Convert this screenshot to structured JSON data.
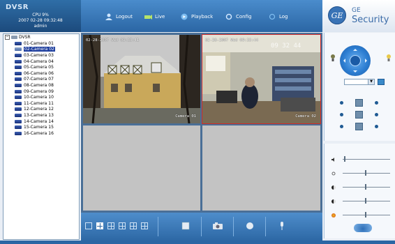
{
  "header": {
    "brand": "DVSR",
    "cpu": "CPU 9%",
    "datetime": "2007 02-28 09:32:48",
    "user": "admin"
  },
  "nav": {
    "tabs": [
      {
        "label": "Logout",
        "icon": "logout-icon"
      },
      {
        "label": "Live",
        "icon": "live-icon"
      },
      {
        "label": "Playback",
        "icon": "playback-icon"
      },
      {
        "label": "Config",
        "icon": "config-icon"
      },
      {
        "label": "Log",
        "icon": "log-icon"
      }
    ]
  },
  "logo": {
    "mark": "GE",
    "line1": "GE",
    "line2": "Security"
  },
  "tree": {
    "root": "DVSR",
    "items": [
      "01-Camera 01",
      "02-Camera 02",
      "03-Camera 03",
      "04-Camera 04",
      "05-Camera 05",
      "06-Camera 06",
      "07-Camera 07",
      "08-Camera 08",
      "09-Camera 09",
      "10-Camera 10",
      "11-Camera 11",
      "12-Camera 12",
      "13-Camera 13",
      "14-Camera 14",
      "15-Camera 15",
      "16-Camera 16"
    ],
    "selected_index": 1
  },
  "video": {
    "cell1": {
      "timestamp": "02-28-2007 Wed 09:33:41",
      "label": "Camera 01"
    },
    "cell2": {
      "timestamp": "02-28-2007 Wed 09:33:44",
      "big_time": "09 32 44",
      "label": "Camera 02"
    }
  },
  "toolbar": {
    "layouts": [
      "single-view",
      "quad-view",
      "six-view",
      "eight-view",
      "nine-view",
      "sixteen-view"
    ],
    "active_layout": 1,
    "actions": [
      "stop",
      "snapshot",
      "record",
      "audio"
    ]
  },
  "colors": {
    "accent": "#2d68a5",
    "selected": "#d12a2a"
  }
}
